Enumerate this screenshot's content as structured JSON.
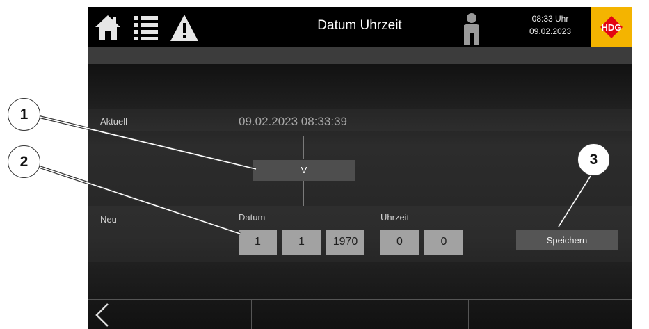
{
  "header": {
    "title": "Datum Uhrzeit",
    "time": "08:33 Uhr",
    "date": "09.02.2023",
    "logo_text": "HDG",
    "icons": [
      "home-icon",
      "list-icon",
      "warning-icon",
      "user-icon"
    ]
  },
  "aktuell": {
    "label": "Aktuell",
    "value": "09.02.2023 08:33:39"
  },
  "take_over": {
    "label": "V"
  },
  "neu": {
    "label": "Neu",
    "datum_label": "Datum",
    "uhrzeit_label": "Uhrzeit",
    "day": "1",
    "month": "1",
    "year": "1970",
    "hour": "0",
    "minute": "0"
  },
  "save": {
    "label": "Speichern"
  },
  "markers": [
    "1",
    "2",
    "3"
  ],
  "colors": {
    "background": "#111111",
    "field": "#a2a2a2",
    "button": "#555555",
    "logo": "#f4b400",
    "logo_accent": "#e30613"
  }
}
